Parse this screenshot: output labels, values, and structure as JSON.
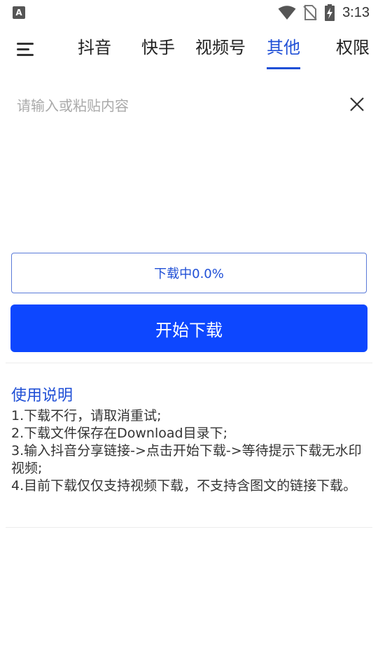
{
  "status_bar": {
    "time": "3:13",
    "app_badge": "A",
    "icons": [
      "wifi-icon",
      "no-sim-icon",
      "battery-charging-icon"
    ]
  },
  "nav": {
    "menu_icon": "menu-icon",
    "tabs": [
      {
        "label": "抖音",
        "active": false
      },
      {
        "label": "快手",
        "active": false
      },
      {
        "label": "视频号",
        "active": false
      },
      {
        "label": "其他",
        "active": true
      },
      {
        "label": "权限",
        "active": false
      }
    ],
    "accent_color": "#1f4fd6"
  },
  "input": {
    "placeholder": "请输入或粘贴内容",
    "value": "",
    "clear_icon": "close-icon"
  },
  "progress": {
    "label": "下载中0.0%",
    "percent": 0.0
  },
  "start_button": {
    "label": "开始下载",
    "color": "#0d47ff"
  },
  "help": {
    "title": "使用说明",
    "lines": [
      "1.下载不行，请取消重试;",
      "2.下载文件保存在Download目录下;",
      "3.输入抖音分享链接->点击开始下载->等待提示下载无水印视频;",
      "4.目前下载仅仅支持视频下载，不支持含图文的链接下载。"
    ]
  }
}
